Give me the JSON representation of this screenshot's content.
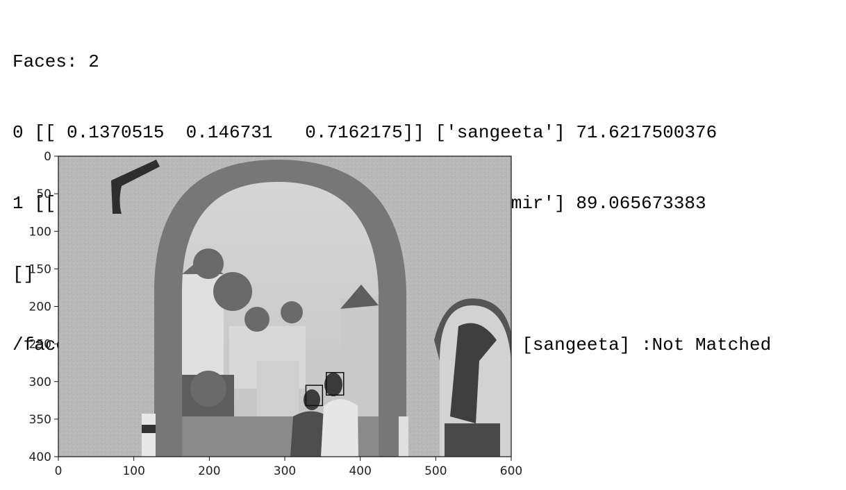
{
  "console": {
    "lines": [
      "Faces: 2",
      "0 [[ 0.1370515  0.146731   0.7162175]] ['sangeeta'] 71.6217500376",
      "1 [[ 0.06332148  0.89065673  0.04602179]] ['samir'] 89.065673383",
      "[]",
      "/faceml/sampleimages/lucerne.jpg : [samir] and [sangeeta] :Not Matched"
    ]
  },
  "plot": {
    "image_description_hidden": "",
    "xlim": [
      0,
      600
    ],
    "ylim": [
      400,
      0
    ],
    "xticks": [
      "0",
      "100",
      "200",
      "300",
      "400",
      "500",
      "600"
    ],
    "yticks": [
      "0",
      "50",
      "100",
      "150",
      "200",
      "250",
      "300",
      "350",
      "400"
    ],
    "face_boxes": [
      {
        "label_index": 0,
        "x0": 328,
        "y0": 305,
        "x1": 350,
        "y1": 332
      },
      {
        "label_index": 1,
        "x0": 355,
        "y0": 288,
        "x1": 378,
        "y1": 318
      }
    ]
  }
}
